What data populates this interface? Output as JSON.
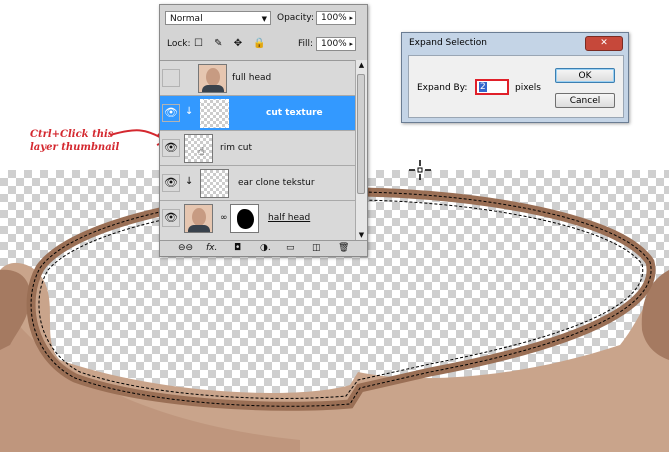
{
  "layers_panel": {
    "blend_mode": "Normal",
    "opacity_label": "Opacity:",
    "opacity_value": "100%",
    "lock_label": "Lock:",
    "lock_icons": "☐ ✎ ✥ 🔒",
    "fill_label": "Fill:",
    "fill_value": "100%",
    "layers": [
      {
        "name": "full head",
        "visible": false,
        "selected": false
      },
      {
        "name": "cut texture",
        "visible": true,
        "selected": true
      },
      {
        "name": "rim cut",
        "visible": true,
        "selected": false
      },
      {
        "name": "ear clone tekstur",
        "visible": true,
        "selected": false
      },
      {
        "name": "half head",
        "visible": true,
        "selected": false
      }
    ],
    "footer_icons": [
      "link-icon",
      "fx-icon",
      "mask-icon",
      "adjustment-icon",
      "group-icon",
      "new-layer-icon",
      "trash-icon"
    ],
    "footer_glyphs": [
      "⊖⊖",
      "fx.",
      "◘",
      "◑.",
      "▭",
      "◫",
      "🗑"
    ]
  },
  "dialog": {
    "title": "Expand Selection",
    "close_glyph": "✕",
    "expand_label": "Expand By:",
    "expand_value": "2",
    "unit": "pixels",
    "ok_label": "OK",
    "cancel_label": "Cancel"
  },
  "annotation": {
    "line1": "Ctrl+Click this",
    "line2": "layer thumbnail"
  },
  "colors": {
    "accent_red": "#d4282f",
    "selection_blue": "#3399ff"
  }
}
